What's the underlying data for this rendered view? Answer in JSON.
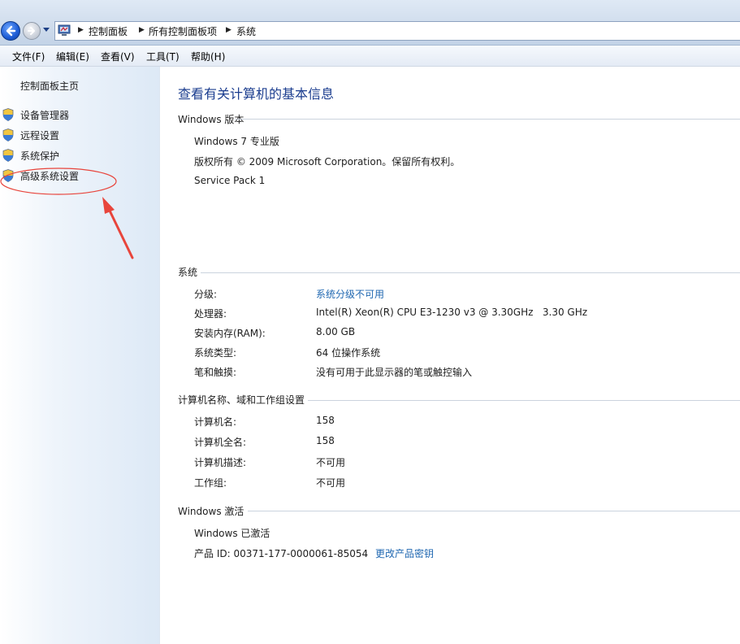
{
  "breadcrumb": {
    "items": [
      "控制面板",
      "所有控制面板项",
      "系统"
    ]
  },
  "menu": {
    "items": [
      "文件(F)",
      "编辑(E)",
      "查看(V)",
      "工具(T)",
      "帮助(H)"
    ]
  },
  "sidebar": {
    "home": "控制面板主页",
    "links": [
      "设备管理器",
      "远程设置",
      "系统保护",
      "高级系统设置"
    ]
  },
  "page_title": "查看有关计算机的基本信息",
  "edition": {
    "heading": "Windows 版本",
    "name": "Windows 7 专业版",
    "copyright": "版权所有 © 2009 Microsoft Corporation。保留所有权利。",
    "service_pack": "Service Pack 1"
  },
  "system": {
    "heading": "系统",
    "rows": [
      {
        "label": "分级:",
        "value": "系统分级不可用",
        "is_link": true
      },
      {
        "label": "处理器:",
        "value": "Intel(R) Xeon(R) CPU E3-1230 v3 @ 3.30GHz   3.30 GHz"
      },
      {
        "label": "安装内存(RAM):",
        "value": "8.00 GB"
      },
      {
        "label": "系统类型:",
        "value": "64 位操作系统"
      },
      {
        "label": "笔和触摸:",
        "value": "没有可用于此显示器的笔或触控输入"
      }
    ]
  },
  "computer": {
    "heading": "计算机名称、域和工作组设置",
    "rows": [
      {
        "label": "计算机名:",
        "value": "158"
      },
      {
        "label": "计算机全名:",
        "value": "158"
      },
      {
        "label": "计算机描述:",
        "value": "不可用"
      },
      {
        "label": "工作组:",
        "value": "不可用"
      }
    ]
  },
  "activation": {
    "heading": "Windows 激活",
    "status": "Windows 已激活",
    "product_id": "产品 ID: 00371-177-0000061-85054",
    "change_key": "更改产品密钥"
  },
  "colors": {
    "link": "#1f67b1",
    "title": "#1b3d8f",
    "annotation": "#e8453c"
  }
}
